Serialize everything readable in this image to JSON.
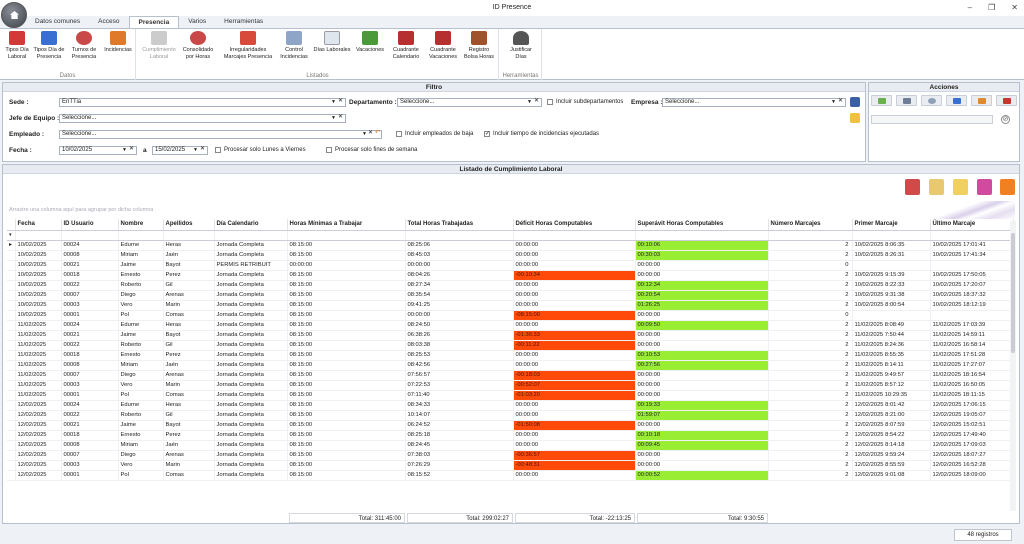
{
  "window": {
    "title": "ID Presence"
  },
  "tabs": [
    "Datos comunes",
    "Acceso",
    "Presencia",
    "Varios",
    "Herramientas"
  ],
  "ribbon": {
    "group1": {
      "label": "Datos",
      "buttons": [
        "Tipos Día\nLaboral",
        "Tipos Día de\nPresencia",
        "Turnos de\nPresencia",
        "Incidencias"
      ]
    },
    "group2": {
      "label": "Listados",
      "buttons": [
        "Cumplimiento\nLaboral",
        "Consolidado\npor Horas",
        "Irregularidades\nMarcajes Presencia",
        "Control\nIncidencias",
        "Días Laborales",
        "Vacaciones",
        "Cuadrante\nCalendario",
        "Cuadrante\nVacaciones",
        "Registro\nBolsa Horas"
      ]
    },
    "group3": {
      "label": "Herramientas",
      "buttons": [
        "Justificar\nDías"
      ]
    }
  },
  "filter": {
    "title": "Filtro",
    "sede_label": "Sede :",
    "sede_value": "EnTTia",
    "depto_label": "Departamento :",
    "depto_value": "Seleccione...",
    "subdep": "Incluir subdepartamentos",
    "empresa_label": "Empresa :",
    "empresa_value": "Seleccione...",
    "jefe_label": "Jefe de Equipo :",
    "jefe_value": "Seleccione...",
    "empleado_label": "Empleado :",
    "empleado_value": "Seleccione...",
    "baja": "Incluir empleados de baja",
    "tiempo": "Incluir tiempo de incidencias ejecutadas",
    "fecha_label": "Fecha :",
    "fecha_from": "10/02/2025",
    "a_label": "a",
    "fecha_to": "15/02/2025",
    "lunes": "Procesar solo Lunes a Viernes",
    "finde": "Procesar solo fines de semana"
  },
  "acciones": {
    "title": "Acciones"
  },
  "grid": {
    "title": "Listado de Cumplimiento Laboral",
    "group_hint": "Arrastre una columna aquí para agrupar por dicha columna",
    "columns": [
      "Fecha",
      "ID Usuario",
      "Nombre",
      "Apellidos",
      "Día Calendario",
      "Horas Mínimas a Trabajar",
      "Total Horas Trabajadas",
      "Déficit Horas Computables",
      "Superávit Horas Computables",
      "Número Marcajes",
      "Primer Marcaje",
      "Último Marcaje"
    ],
    "rows": [
      [
        "10/02/2025",
        "00024",
        "Edurne",
        "Heras",
        "Jornada Completa",
        "08:15:00",
        "08:25:06",
        "00:00:00",
        "00:10:06",
        "2",
        "10/02/2025 8:06:35",
        "10/02/2025 17:01:41"
      ],
      [
        "10/02/2025",
        "00008",
        "Miriam",
        "Jaén",
        "Jornada Completa",
        "08:15:00",
        "08:45:03",
        "00:00:00",
        "00:30:03",
        "2",
        "10/02/2025 8:26:31",
        "10/02/2025 17:41:34"
      ],
      [
        "10/02/2025",
        "00021",
        "Jaime",
        "Bayot",
        "PERMIS RETRIBUIT",
        "00:00:00",
        "00:00:00",
        "00:00:00",
        "00:00:00",
        "0",
        "",
        ""
      ],
      [
        "10/02/2025",
        "00018",
        "Ernesto",
        "Perez",
        "Jornada Completa",
        "08:15:00",
        "08:04:26",
        "-00:10:34",
        "00:00:00",
        "2",
        "10/02/2025 9:15:39",
        "10/02/2025 17:50:05"
      ],
      [
        "10/02/2025",
        "00022",
        "Roberto",
        "Gil",
        "Jornada Completa",
        "08:15:00",
        "08:27:34",
        "00:00:00",
        "00:12:34",
        "2",
        "10/02/2025 8:22:33",
        "10/02/2025 17:20:07"
      ],
      [
        "10/02/2025",
        "00007",
        "Diego",
        "Arenas",
        "Jornada Completa",
        "08:15:00",
        "08:35:54",
        "00:00:00",
        "00:20:54",
        "2",
        "10/02/2025 9:31:38",
        "10/02/2025 18:37:32"
      ],
      [
        "10/02/2025",
        "00003",
        "Vero",
        "Marin",
        "Jornada Completa",
        "08:15:00",
        "09:41:25",
        "00:00:00",
        "01:26:25",
        "2",
        "10/02/2025 8:00:54",
        "10/02/2025 18:12:19"
      ],
      [
        "10/02/2025",
        "00001",
        "Pol",
        "Comas",
        "Jornada Completa",
        "08:15:00",
        "00:00:00",
        "-08:15:00",
        "00:00:00",
        "0",
        "",
        ""
      ],
      [
        "11/02/2025",
        "00024",
        "Edurne",
        "Heras",
        "Jornada Completa",
        "08:15:00",
        "08:24:50",
        "00:00:00",
        "00:09:50",
        "2",
        "11/02/2025 8:08:49",
        "11/02/2025 17:03:39"
      ],
      [
        "11/02/2025",
        "00021",
        "Jaime",
        "Bayot",
        "Jornada Completa",
        "08:15:00",
        "06:38:26",
        "-01:36:33",
        "00:00:00",
        "2",
        "11/02/2025 7:50:44",
        "11/02/2025 14:59:11"
      ],
      [
        "11/02/2025",
        "00022",
        "Roberto",
        "Gil",
        "Jornada Completa",
        "08:15:00",
        "08:03:38",
        "-00:11:22",
        "00:00:00",
        "2",
        "11/02/2025 8:24:36",
        "11/02/2025 16:58:14"
      ],
      [
        "11/02/2025",
        "00018",
        "Ernesto",
        "Perez",
        "Jornada Completa",
        "08:15:00",
        "08:25:53",
        "00:00:00",
        "00:10:53",
        "2",
        "11/02/2025 8:55:35",
        "11/02/2025 17:51:28"
      ],
      [
        "11/02/2025",
        "00008",
        "Miriam",
        "Jaén",
        "Jornada Completa",
        "08:15:00",
        "08:42:56",
        "00:00:00",
        "00:27:56",
        "2",
        "11/02/2025 8:14:11",
        "11/02/2025 17:27:07"
      ],
      [
        "11/02/2025",
        "00007",
        "Diego",
        "Arenas",
        "Jornada Completa",
        "08:15:00",
        "07:56:57",
        "-00:18:03",
        "00:00:00",
        "2",
        "11/02/2025 9:49:57",
        "11/02/2025 18:16:54"
      ],
      [
        "11/02/2025",
        "00003",
        "Vero",
        "Marin",
        "Jornada Completa",
        "08:15:00",
        "07:22:53",
        "-00:52:07",
        "00:00:00",
        "2",
        "11/02/2025 8:57:12",
        "11/02/2025 16:50:05"
      ],
      [
        "11/02/2025",
        "00001",
        "Pol",
        "Comas",
        "Jornada Completa",
        "08:15:00",
        "07:11:40",
        "-01:03:20",
        "00:00:00",
        "2",
        "11/02/2025 10:29:35",
        "11/02/2025 18:11:15"
      ],
      [
        "12/02/2025",
        "00024",
        "Edurne",
        "Heras",
        "Jornada Completa",
        "08:15:00",
        "08:34:33",
        "00:00:00",
        "00:19:33",
        "2",
        "12/02/2025 8:01:42",
        "12/02/2025 17:06:15"
      ],
      [
        "12/02/2025",
        "00022",
        "Roberto",
        "Gil",
        "Jornada Completa",
        "08:15:00",
        "10:14:07",
        "00:00:00",
        "01:59:07",
        "2",
        "12/02/2025 8:21:00",
        "12/02/2025 19:05:07"
      ],
      [
        "12/02/2025",
        "00021",
        "Jaime",
        "Bayot",
        "Jornada Completa",
        "08:15:00",
        "06:24:52",
        "-01:50:08",
        "00:00:00",
        "2",
        "12/02/2025 8:07:59",
        "12/02/2025 15:02:51"
      ],
      [
        "12/02/2025",
        "00018",
        "Ernesto",
        "Perez",
        "Jornada Completa",
        "08:15:00",
        "08:25:18",
        "00:00:00",
        "00:10:18",
        "2",
        "12/02/2025 8:54:22",
        "12/02/2025 17:49:40"
      ],
      [
        "12/02/2025",
        "00008",
        "Miriam",
        "Jaén",
        "Jornada Completa",
        "08:15:00",
        "08:24:45",
        "00:00:00",
        "00:09:45",
        "2",
        "12/02/2025 8:14:18",
        "12/02/2025 17:09:03"
      ],
      [
        "12/02/2025",
        "00007",
        "Diego",
        "Arenas",
        "Jornada Completa",
        "08:15:00",
        "07:38:03",
        "-00:36:57",
        "00:00:00",
        "2",
        "12/02/2025 9:59:24",
        "12/02/2025 18:07:27"
      ],
      [
        "12/02/2025",
        "00003",
        "Vero",
        "Marin",
        "Jornada Completa",
        "08:15:00",
        "07:26:29",
        "-00:48:31",
        "00:00:00",
        "2",
        "12/02/2025 8:55:59",
        "12/02/2025 16:52:28"
      ],
      [
        "12/02/2025",
        "00001",
        "Pol",
        "Comas",
        "Jornada Completa",
        "08:15:00",
        "08:15:52",
        "00:00:00",
        "00:00:52",
        "2",
        "12/02/2025 9:01:08",
        "12/02/2025 18:09:00"
      ]
    ],
    "totals": {
      "min": "Total: 311:45:00",
      "trab": "Total: 299:02:27",
      "def": "Total: -22:13:25",
      "sup": "Total: 9:30:55"
    },
    "records": "48 registros"
  },
  "colors": {
    "deficit": "#ff4a0a",
    "superavit": "#99ee33"
  }
}
